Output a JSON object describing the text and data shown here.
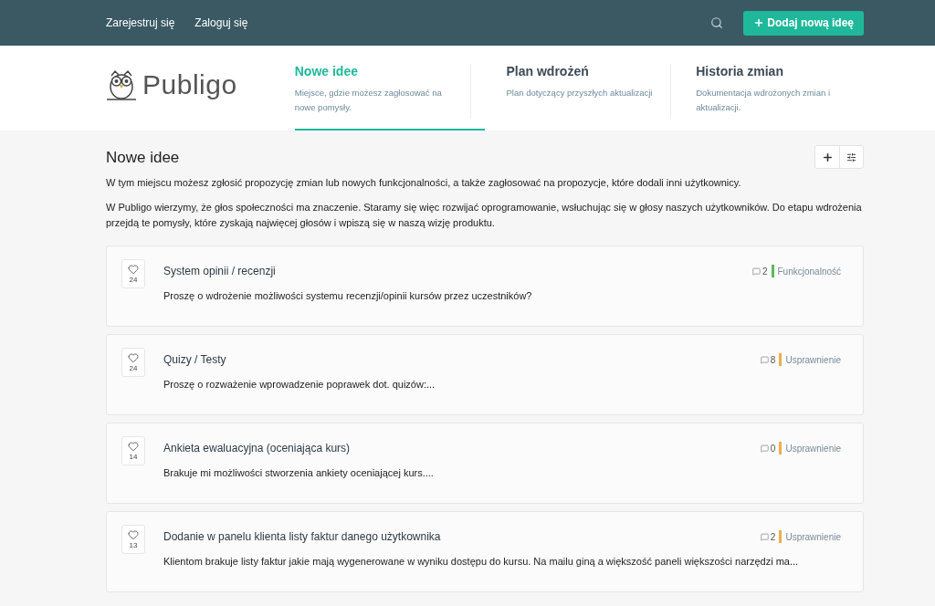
{
  "topbar": {
    "links": [
      "Zarejestruj się",
      "Zaloguj się"
    ],
    "add_button": "Dodaj nową ideę"
  },
  "logo": {
    "text": "Publigo"
  },
  "tabs": [
    {
      "title": "Nowe idee",
      "description": "Miejsce, gdzie możesz zagłosować na nowe pomysły.",
      "selected": true
    },
    {
      "title": "Plan wdrożeń",
      "description": "Plan dotyczący przyszłych aktualizacji",
      "selected": false
    },
    {
      "title": "Historia zmian",
      "description": "Dokumentacja wdrożonych zmian i aktualizacji.",
      "selected": false
    }
  ],
  "section": {
    "title": "Nowe idee",
    "paragraphs": [
      "W tym miejscu możesz zgłosić propozycję zmian lub nowych funkcjonalności, a także zagłosować na propozycje, które dodali inni użytkownicy.",
      "W Publigo wierzymy, że głos społeczności ma znaczenie. Staramy się więc rozwijać oprogramowanie, wsłuchując się w głosy naszych użytkowników. Do etapu wdrożenia przejdą te pomysły, które zyskają najwięcej głosów i wpiszą się w naszą wizję produktu."
    ]
  },
  "ideas": [
    {
      "votes": "24",
      "title": "System opinii / recenzji",
      "excerpt": "Proszę o wdrożenie możliwości systemu recenzji/opinii kursów przez uczestników?",
      "comments": "2",
      "category": "Funkcjonalność",
      "color": "#5cb85c"
    },
    {
      "votes": "24",
      "title": "Quizy / Testy",
      "excerpt": "Proszę o rozważenie wprowadzenie poprawek dot. quizów:...",
      "comments": "8",
      "category": "Usprawnienie",
      "color": "#f0ad4e"
    },
    {
      "votes": "14",
      "title": "Ankieta ewaluacyjna (oceniająca kurs)",
      "excerpt": "Brakuje mi możliwości stworzenia ankiety oceniającej kurs....",
      "comments": "0",
      "category": "Usprawnienie",
      "color": "#f0ad4e"
    },
    {
      "votes": "13",
      "title": "Dodanie w panelu klienta listy faktur danego użytkownika",
      "excerpt": "Klientom brakuje listy faktur jakie mają wygenerowane w wyniku dostępu do kursu. Na mailu giną a większość paneli większości narzędzi ma...",
      "comments": "2",
      "category": "Usprawnienie",
      "color": "#f0ad4e"
    }
  ]
}
